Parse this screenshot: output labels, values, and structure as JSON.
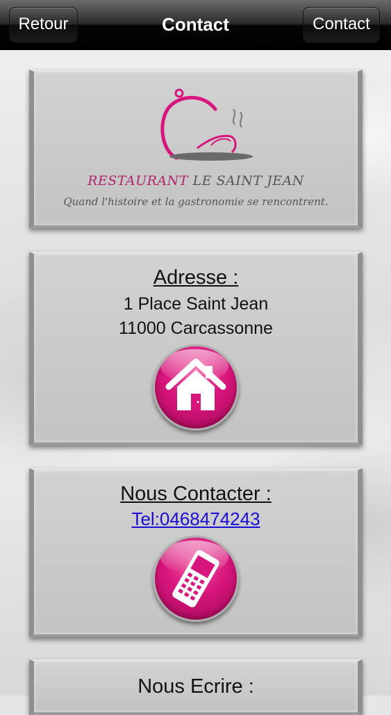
{
  "navbar": {
    "back_label": "Retour",
    "title": "Contact",
    "right_label": "Contact"
  },
  "logo": {
    "name_pink": "RESTAURANT",
    "name_grey": " LE SAINT JEAN",
    "tagline": "Quand l'histoire et la gastronomie se rencontrent.",
    "icon": "cloche-icon"
  },
  "address": {
    "heading": "Adresse :",
    "line1": "1 Place Saint Jean",
    "line2": "11000 Carcassonne",
    "button_icon": "home-icon"
  },
  "contact": {
    "heading": "Nous Contacter :",
    "phone_link": "Tel:0468474243",
    "button_icon": "mobile-phone-icon"
  },
  "write": {
    "heading": "Nous Ecrire :"
  },
  "colors": {
    "accent_pink": "#d8157c",
    "link_blue": "#1a0dd6",
    "navbar": "#000000"
  }
}
